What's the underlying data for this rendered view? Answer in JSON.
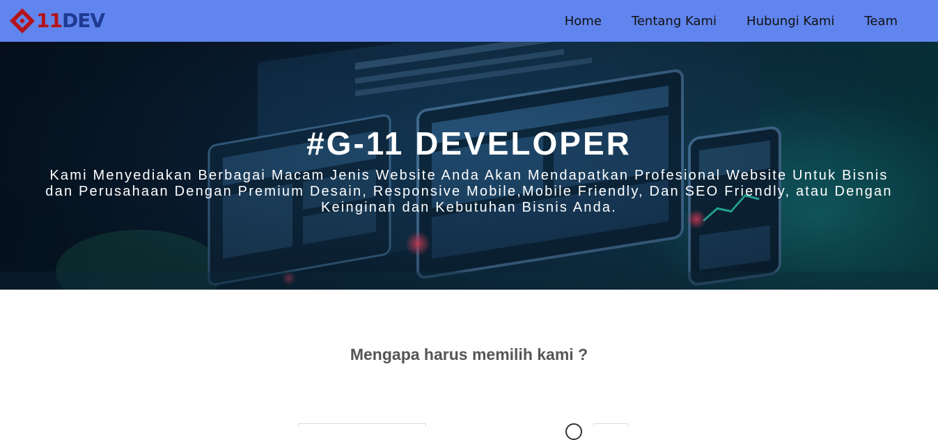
{
  "brand": {
    "logo_num": "11",
    "logo_dev": "DEV",
    "colors": {
      "navbar": "#6185ee",
      "logo_red": "#b3141b",
      "logo_blue": "#1f3a93"
    }
  },
  "nav": {
    "items": [
      {
        "label": "Home"
      },
      {
        "label": "Tentang Kami"
      },
      {
        "label": "Hubungi Kami"
      },
      {
        "label": "Team"
      }
    ]
  },
  "hero": {
    "title": "#G-11 DEVELOPER",
    "description": "Kami Menyediakan Berbagai Macam Jenis Website Anda Akan Mendapatkan Profesional Website Untuk Bisnis dan Perusahaan Dengan Premium Desain, Responsive Mobile,Mobile Friendly, Dan SEO Friendly, atau Dengan Keinginan dan Kebutuhan Bisnis Anda."
  },
  "why": {
    "title": "Mengapa harus memilih kami ?"
  }
}
